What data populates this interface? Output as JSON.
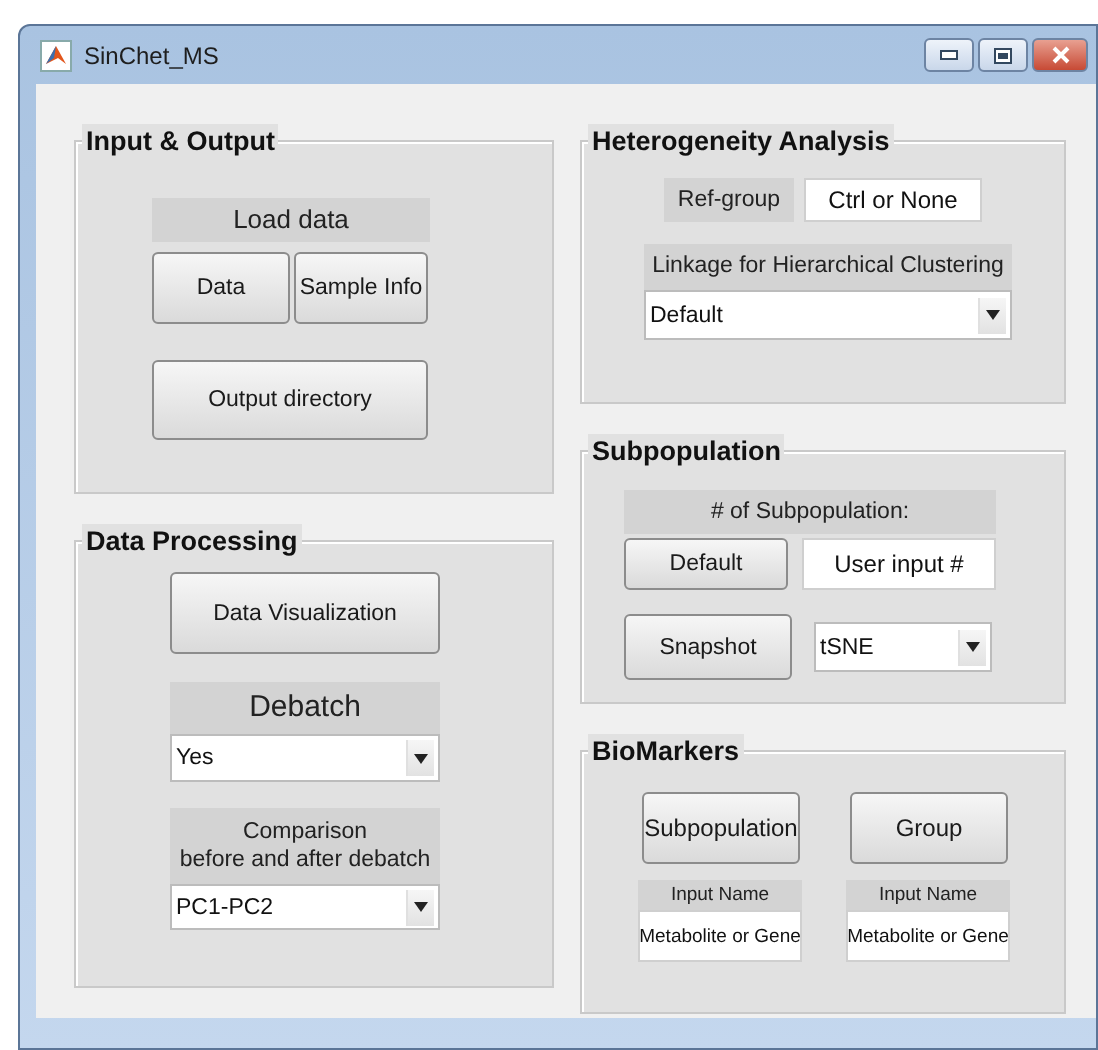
{
  "window": {
    "title": "SinChet_MS"
  },
  "input_output": {
    "title": "Input & Output",
    "load_label": "Load data",
    "buttons": [
      "Data",
      "Sample Info"
    ],
    "output_button": "Output directory"
  },
  "data_processing": {
    "title": "Data Processing",
    "visualize_button": "Data Visualization",
    "debatch": {
      "label": "Debatch",
      "value": "Yes"
    },
    "comparison": {
      "label": "Comparison\nbefore and after debatch",
      "value": "PC1-PC2"
    }
  },
  "heterogeneity": {
    "title": "Heterogeneity Analysis",
    "ref_label": "Ref-group",
    "ref_value": "Ctrl or None",
    "linkage_label": "Linkage for Hierarchical Clustering",
    "linkage_value": "Default"
  },
  "subpopulation": {
    "title": "Subpopulation",
    "count_label": "# of Subpopulation:",
    "default_button": "Default",
    "count_value": "User input #",
    "snapshot_button": "Snapshot",
    "method_value": "tSNE"
  },
  "biomarkers": {
    "title": "BioMarkers",
    "columns": [
      {
        "button": "Subpopulation",
        "label": "Input Name",
        "value": "Metabolite or Gene"
      },
      {
        "button": "Group",
        "label": "Input Name",
        "value": "Metabolite or Gene"
      }
    ]
  }
}
